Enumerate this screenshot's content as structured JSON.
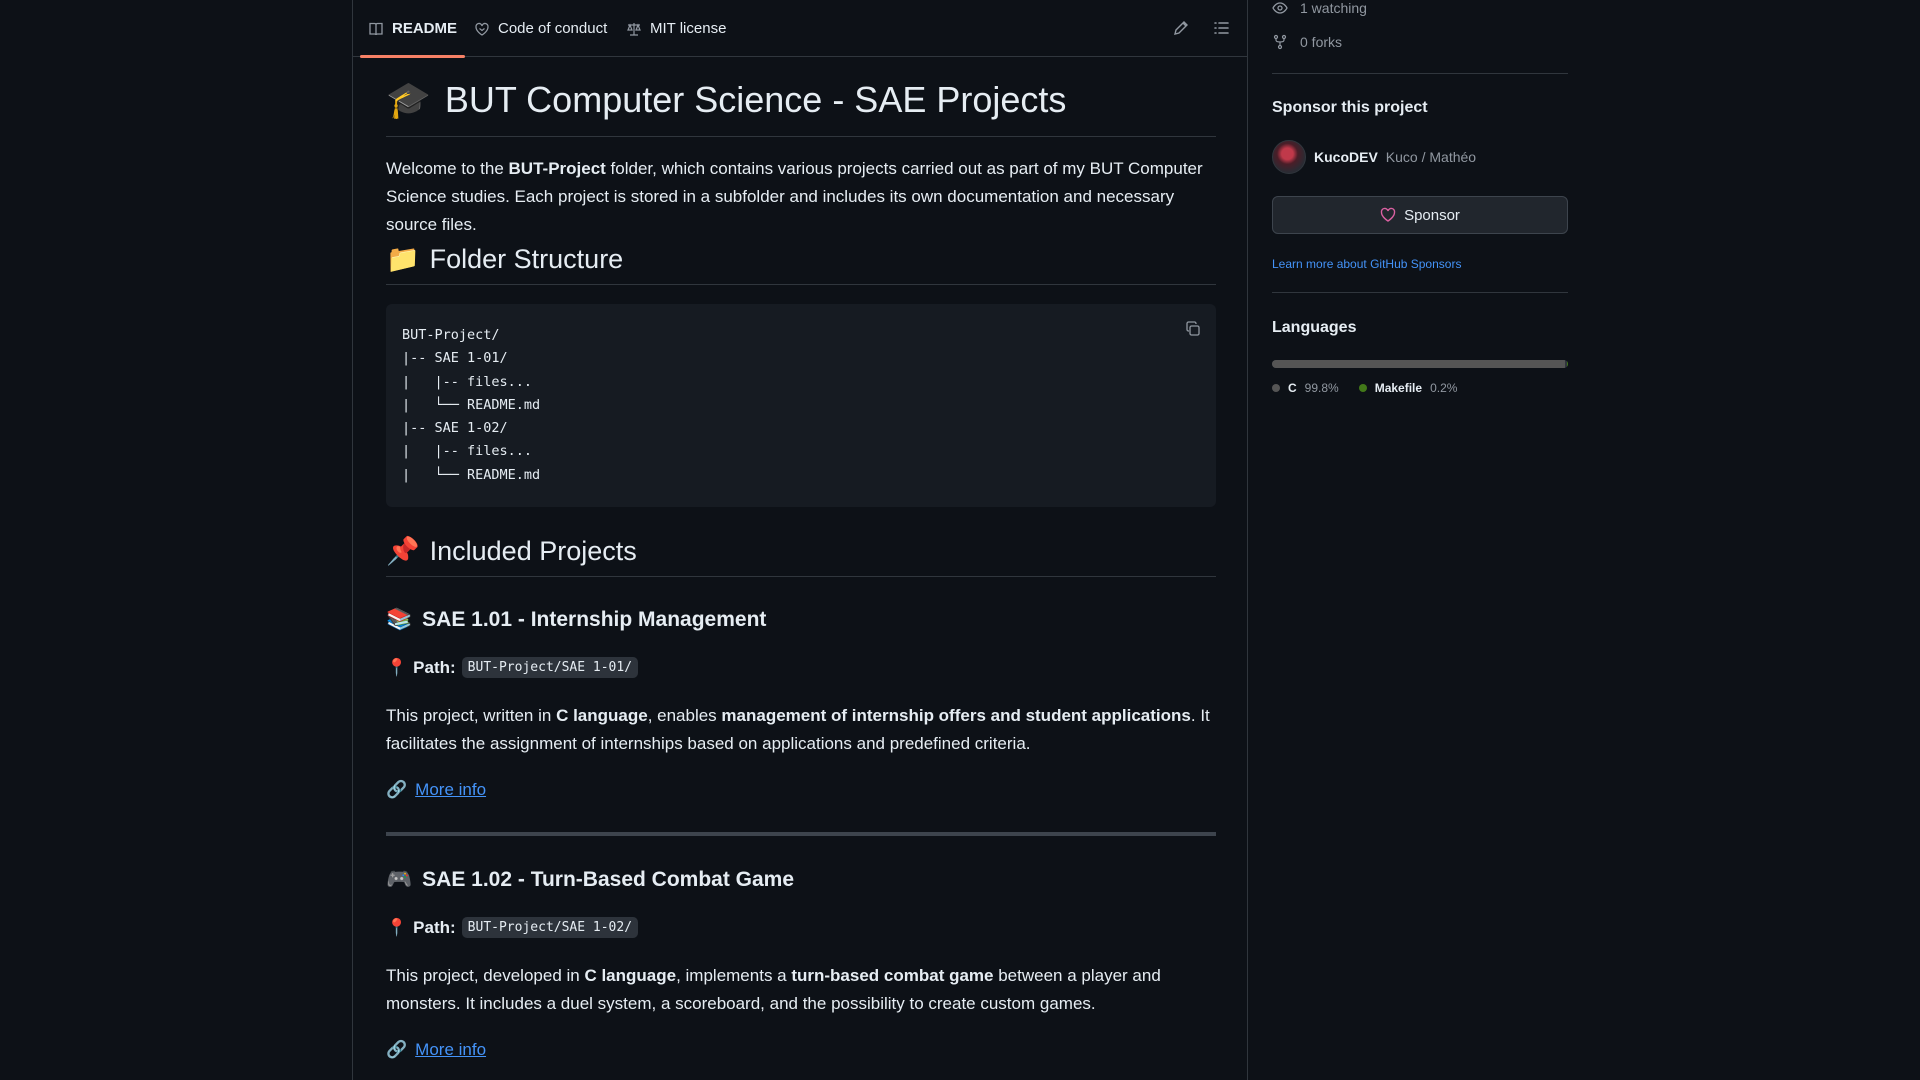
{
  "tabs": [
    {
      "label": "README",
      "icon": "book-icon"
    },
    {
      "label": "Code of conduct",
      "icon": "code-of-conduct-icon"
    },
    {
      "label": "MIT license",
      "icon": "law-icon"
    }
  ],
  "readme": {
    "title_emoji": "🎓",
    "title": "BUT Computer Science - SAE Projects",
    "intro": {
      "part1": "Welcome to the ",
      "bold1": "BUT-Project",
      "part2": " folder, which contains various projects carried out as part of my BUT Computer Science studies. Each project is stored in a subfolder and includes its own documentation and necessary source files."
    },
    "folder_section": {
      "emoji": "📁",
      "heading": "Folder Structure"
    },
    "folder_tree": "BUT-Project/\n|-- SAE 1-01/\n|   |-- files...\n|   └── README.md\n|-- SAE 1-02/\n|   |-- files...\n|   └── README.md",
    "projects_section": {
      "emoji": "📌",
      "heading": "Included Projects"
    },
    "projects": [
      {
        "emoji": "📚",
        "title": "SAE 1.01 - Internship Management",
        "path_emoji": "📍",
        "path_label": "Path:",
        "path": "BUT-Project/SAE 1-01/",
        "desc_p1": "This project, written in ",
        "desc_b1": "C language",
        "desc_p2": ", enables ",
        "desc_b2": "management of internship offers and student applications",
        "desc_p3": ". It facilitates the assignment of internships based on applications and predefined criteria.",
        "link_emoji": "🔗",
        "link_text": "More info"
      },
      {
        "emoji": "🎮",
        "title": "SAE 1.02 - Turn-Based Combat Game",
        "path_emoji": "📍",
        "path_label": "Path:",
        "path": "BUT-Project/SAE 1-02/",
        "desc_p1": "This project, developed in ",
        "desc_b1": "C language",
        "desc_p2": ", implements a ",
        "desc_b2": "turn-based combat game",
        "desc_p3": " between a player and monsters. It includes a duel system, a scoreboard, and the possibility to create custom games.",
        "link_emoji": "🔗",
        "link_text": "More info"
      }
    ]
  },
  "sidebar": {
    "watching": "1 watching",
    "forks": "0 forks",
    "sponsor_heading": "Sponsor this project",
    "sponsor_user": "KucoDEV",
    "sponsor_name": "Kuco / Mathéo",
    "sponsor_button": "Sponsor",
    "learn_more": "Learn more about GitHub Sponsors",
    "languages_heading": "Languages",
    "languages": [
      {
        "name": "C",
        "percent": "99.8%",
        "value": 99.8,
        "color": "#555555"
      },
      {
        "name": "Makefile",
        "percent": "0.2%",
        "value": 0.2,
        "color": "#427819"
      }
    ]
  }
}
